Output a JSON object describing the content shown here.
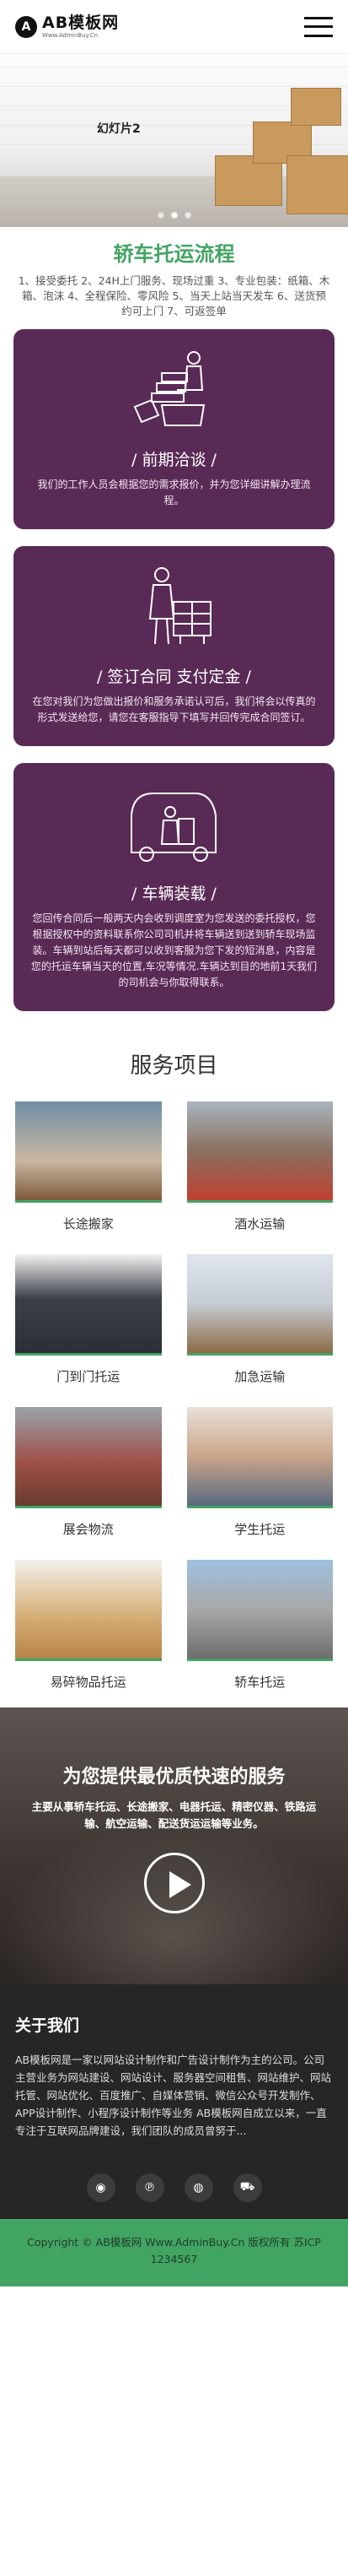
{
  "header": {
    "logo_mark": "A",
    "logo_title": "AB模板网",
    "logo_sub": "Www.AdminBuy.Cn"
  },
  "banner": {
    "title": "幻灯片2",
    "slide_count": 3,
    "active_slide": 2
  },
  "process": {
    "title": "轿车托运流程",
    "intro": "1、接受委托 2、24H上门服务、现场过重 3、专业包装：纸箱、木箱、泡沫 4、全程保险、零风险 5、当天上站当天发车 6、送货预约可上门 7、可返签单",
    "steps": [
      {
        "title": "/ 前期洽谈 /",
        "text": "我们的工作人员会根据您的需求报价，并为您详细讲解办理流程。",
        "icon": "negotiation-icon"
      },
      {
        "title": "/ 签订合同 支付定金 /",
        "text": "在您对我们为您做出报价和服务承诺认可后，我们将会以传真的形式发送给您，请您在客服指导下填写并回传完成合同签订。",
        "icon": "contract-icon"
      },
      {
        "title": "/ 车辆装载 /",
        "text": "您回传合同后一般两天内会收到调度室为您发送的委托授权，您根据授权中的资料联系你公司司机并将车辆送到送到轿车现场监装。车辆到站后每天都可以收到客服为您下发的短消息，内容是您的托运车辆当天的位置,车况等情况.车辆达到目的地前1天我们的司机会与你取得联系。",
        "icon": "loading-icon"
      }
    ]
  },
  "services": {
    "title": "服务项目",
    "items": [
      {
        "label": "长途搬家"
      },
      {
        "label": "酒水运输"
      },
      {
        "label": "门到门托运"
      },
      {
        "label": "加急运输"
      },
      {
        "label": "展会物流"
      },
      {
        "label": "学生托运"
      },
      {
        "label": "易碎物品托运"
      },
      {
        "label": "轿车托运"
      }
    ]
  },
  "promo": {
    "title": "为您提供最优质快速的服务",
    "text": "主要从事轿车托运、长途搬家、电器托运、精密仪器、铁路运输、航空运输、配送货运运输等业务。"
  },
  "about": {
    "title": "关于我们",
    "text": "AB模板网是一家以网站设计制作和广告设计制作为主的公司。公司主营业务为网站建设、网站设计、服务器空间租售、网站维护、网站托管、网站优化、百度推广、自媒体营销、微信公众号开发制作、APP设计制作、小程序设计制作等业务 AB模板网自成立以来，一直专注于互联网品牌建设，我们团队的成员曾努于..."
  },
  "social": [
    {
      "icon": "weibo-icon",
      "glyph": "◉"
    },
    {
      "icon": "pinterest-icon",
      "glyph": "℗"
    },
    {
      "icon": "qq-icon",
      "glyph": "◍"
    },
    {
      "icon": "cart-icon",
      "glyph": "⛟"
    }
  ],
  "footer": {
    "text": "Copyright © AB模板网 Www.AdminBuy.Cn 版权所有 苏ICP 1234567"
  }
}
